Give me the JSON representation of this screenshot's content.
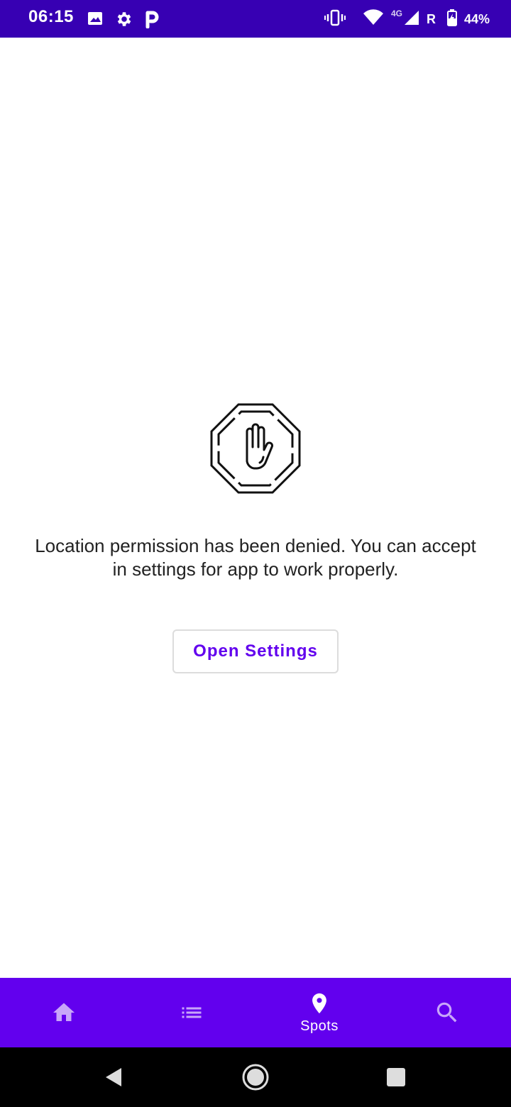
{
  "status_bar": {
    "time": "06:15",
    "network": "4G",
    "roaming": "R",
    "battery": "44%",
    "icons": [
      "image-icon",
      "gear-icon",
      "parking-icon",
      "vibrate-icon",
      "wifi-icon",
      "signal-icon",
      "battery-icon"
    ]
  },
  "main": {
    "icon": "stop-hand-icon",
    "message": "Location permission has been denied. You can accept in settings for app to work properly.",
    "button_label": "Open Settings"
  },
  "bottom_nav": {
    "items": [
      {
        "name": "home",
        "icon": "home-icon",
        "label": ""
      },
      {
        "name": "list",
        "icon": "list-icon",
        "label": ""
      },
      {
        "name": "spots",
        "icon": "location-pin-icon",
        "label": "Spots",
        "selected": true
      },
      {
        "name": "search",
        "icon": "search-icon",
        "label": ""
      }
    ]
  },
  "system_nav": {
    "icons": [
      "back-icon",
      "home-circle-icon",
      "recents-icon"
    ]
  },
  "colors": {
    "status_bar": "#3700b3",
    "primary": "#6200ee",
    "text": "#222222",
    "button_text": "#6200ee"
  }
}
